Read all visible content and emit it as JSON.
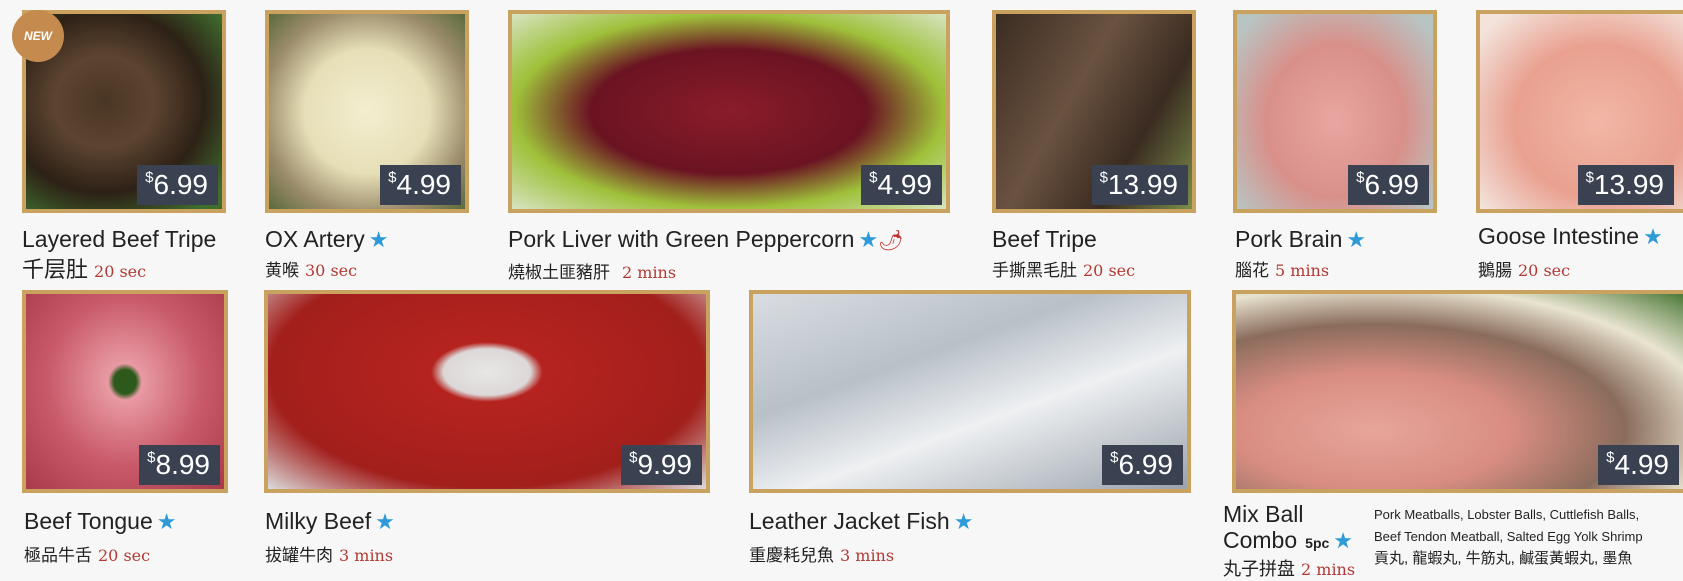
{
  "items": [
    {
      "name": "Layered Beef Tripe",
      "zh": "千层肚",
      "time": "20 sec",
      "price": "6.99",
      "currency": "$",
      "badge": "NEW",
      "star": false,
      "spicy": false
    },
    {
      "name": "OX Artery",
      "zh": "黄喉",
      "time": "30 sec",
      "price": "4.99",
      "currency": "$",
      "star": true
    },
    {
      "name": "Pork Liver with Green Peppercorn",
      "zh": "燒椒土匪豬肝",
      "time": "2 mins",
      "price": "4.99",
      "currency": "$",
      "star": true,
      "spicy": true
    },
    {
      "name": "Beef Tripe",
      "zh": "手撕黑毛肚",
      "time": "20 sec",
      "price": "13.99",
      "currency": "$",
      "star": false
    },
    {
      "name": "Pork Brain",
      "zh": "腦花",
      "time": "5 mins",
      "price": "6.99",
      "currency": "$",
      "star": true
    },
    {
      "name": "Goose Intestine",
      "zh": "鵝腸",
      "time": "20 sec",
      "price": "13.99",
      "currency": "$",
      "star": true
    },
    {
      "name": "Beef Tongue",
      "zh": "極品牛舌",
      "time": "20 sec",
      "price": "8.99",
      "currency": "$",
      "star": true
    },
    {
      "name": "Milky Beef",
      "zh": "拔罐牛肉",
      "time": "3 mins",
      "price": "9.99",
      "currency": "$",
      "star": true
    },
    {
      "name": "Leather Jacket Fish",
      "zh": "重慶耗兒魚",
      "time": "3 mins",
      "price": "6.99",
      "currency": "$",
      "star": true
    },
    {
      "name_line1": "Mix Ball",
      "name_line2": "Combo",
      "count": "5pc",
      "zh": "丸子拼盘",
      "time": "2 mins",
      "price": "4.99",
      "currency": "$",
      "star": true,
      "desc_line1": "Pork Meatballs, Lobster Balls, Cuttlefish Balls,",
      "desc_line2": "Beef Tendon Meatball, Salted Egg Yolk Shrimp",
      "desc_line3": "貢丸, 龍蝦丸, 牛筋丸, 鹹蛋黃蝦丸, 墨魚"
    }
  ],
  "icons": {
    "star": "star-icon",
    "spicy": "chili-pepper-icon"
  },
  "colors": {
    "frame": "#c9a25f",
    "price_bg": "#3a4150",
    "star": "#2f9ad8",
    "time": "#b23a34"
  }
}
